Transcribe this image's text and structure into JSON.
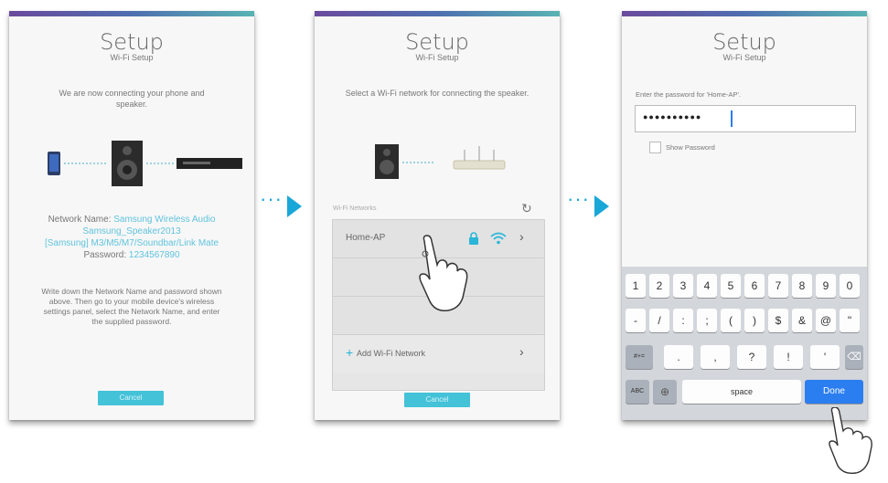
{
  "screen1": {
    "title": "Setup",
    "subtitle": "Wi-Fi Setup",
    "message": "We are now connecting your phone and speaker.",
    "network_label": "Network Name:",
    "network_value_1": "Samsung Wireless Audio",
    "network_value_2": "Samsung_Speaker2013",
    "network_value_3": "[Samsung] M3/M5/M7/Soundbar/Link Mate",
    "password_label": "Password:",
    "password_value": "1234567890",
    "instructions": "Write down the Network Name and password shown above. Then go to your mobile device's wireless settings panel, select the Network Name, and enter the supplied password.",
    "cancel_label": "Cancel"
  },
  "screen2": {
    "title": "Setup",
    "subtitle": "Wi-Fi Setup",
    "message": "Select a Wi-Fi network for connecting the speaker.",
    "networks_header": "Wi-Fi Networks",
    "networks": [
      {
        "name": "Home-AP"
      },
      {
        "name": ""
      },
      {
        "name": ""
      }
    ],
    "add_network_label": "Add Wi-Fi Network",
    "cancel_label": "Cancel"
  },
  "screen3": {
    "title": "Setup",
    "subtitle": "Wi-Fi Setup",
    "prompt": "Enter the password for 'Home-AP'.",
    "password_value": "●●●●●●●●●●",
    "show_password_label": "Show Password",
    "keyboard": {
      "row1": [
        "1",
        "2",
        "3",
        "4",
        "5",
        "6",
        "7",
        "8",
        "9",
        "0"
      ],
      "row2": [
        "-",
        "/",
        ":",
        ";",
        "(",
        ")",
        "$",
        "&",
        "@",
        "\""
      ],
      "more_symbols": "#+=",
      "row3": [
        ".",
        ",",
        "?",
        "!",
        "'"
      ],
      "abc": "ABC",
      "space": "space",
      "done": "Done"
    }
  },
  "colors": {
    "accent": "#43c2d8",
    "arrow": "#19a7d8",
    "done": "#2b7ef0"
  }
}
